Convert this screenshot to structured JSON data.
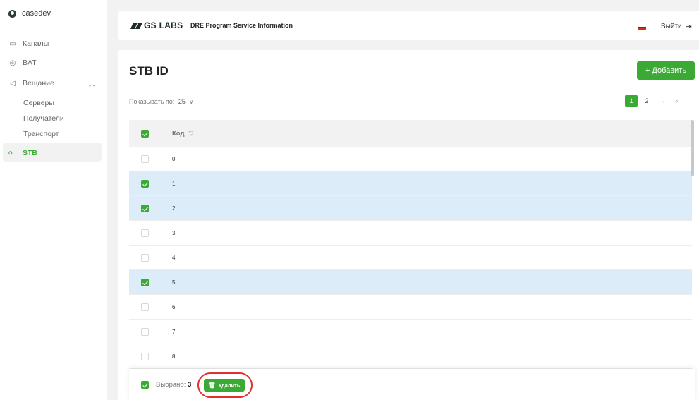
{
  "sidebar": {
    "user": "casedev",
    "items": [
      {
        "label": "Каналы"
      },
      {
        "label": "BAT"
      },
      {
        "label": "Вещание"
      }
    ],
    "broadcast_sub": [
      "Серверы",
      "Получатели",
      "Транспорт"
    ],
    "active_item": "STB"
  },
  "header": {
    "logo_text": "GS LABS",
    "app_title": "DRE Program Service Information",
    "logout_label": "Выйти",
    "flag_colors": [
      "#ffffff",
      "#1c3fa8",
      "#d52b1e"
    ]
  },
  "main": {
    "title": "STB ID",
    "add_button": "+ Добавить",
    "per_page_label": "Показывать по:",
    "per_page_value": "25",
    "pagination": {
      "pages": [
        "1",
        "2"
      ],
      "current": "1",
      "next": "→",
      "last": "›I"
    },
    "table": {
      "column_header": "Код",
      "header_checked": true,
      "rows": [
        {
          "code": "0",
          "selected": false
        },
        {
          "code": "1",
          "selected": true
        },
        {
          "code": "2",
          "selected": true
        },
        {
          "code": "3",
          "selected": false
        },
        {
          "code": "4",
          "selected": false
        },
        {
          "code": "5",
          "selected": true
        },
        {
          "code": "6",
          "selected": false
        },
        {
          "code": "7",
          "selected": false
        },
        {
          "code": "8",
          "selected": false
        }
      ]
    }
  },
  "footer": {
    "selected_label": "Выбрано:",
    "selected_count": "3",
    "delete_label": "Удалить"
  },
  "colors": {
    "accent": "#3aaa35",
    "selected_row": "#dcecf8"
  }
}
